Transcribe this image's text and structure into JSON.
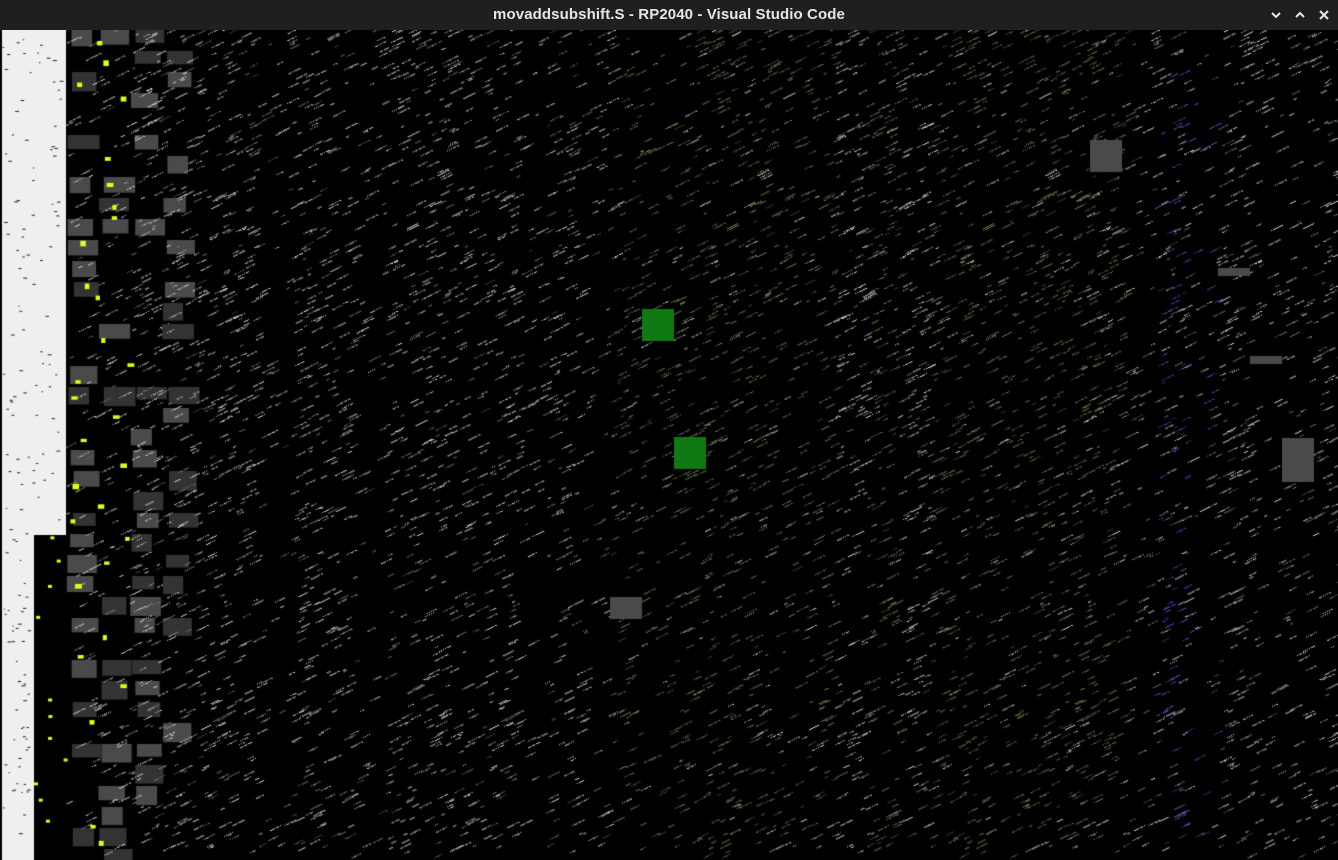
{
  "window": {
    "title": "movaddsubshift.S - RP2040 - Visual Studio Code",
    "controls": [
      {
        "name": "minimize-button",
        "icon": "chevron-down-icon"
      },
      {
        "name": "maximize-button",
        "icon": "chevron-up-icon"
      },
      {
        "name": "close-button",
        "icon": "close-icon"
      }
    ]
  },
  "colors": {
    "titlebar_bg": "#1f1f1f",
    "titlebar_text": "#e6e6e6",
    "content_bg": "#000000",
    "left_panel": "#efefef",
    "noise_white": "#d9d9d9",
    "noise_green": "#6f8a55",
    "noise_blue": "#5a5ad6",
    "accent_yellow": "#dcff1e",
    "block_gray": "#4a4a4a",
    "block_green": "#0f7a14"
  },
  "content": {
    "state": "corrupted-render"
  }
}
